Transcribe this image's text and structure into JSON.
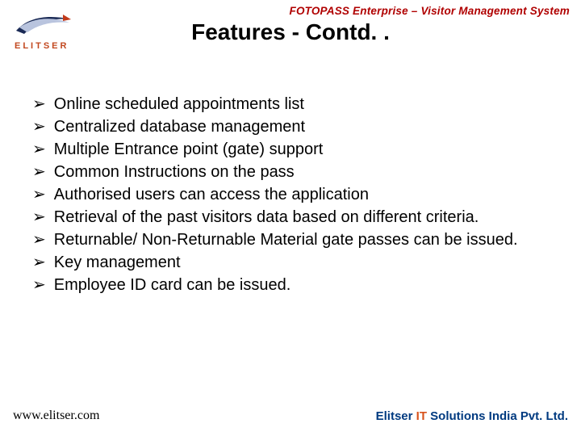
{
  "header": {
    "product_line": "FOTOPASS Enterprise – Visitor Management System",
    "title": "Features - Contd. ."
  },
  "logo": {
    "brand_text": "ELITSER"
  },
  "bullets": [
    "Online scheduled appointments list",
    "Centralized database management",
    "Multiple Entrance point (gate) support",
    "Common Instructions on the pass",
    "Authorised users can access the application",
    "Retrieval of the past visitors data based on different criteria.",
    "Returnable/ Non-Returnable Material gate passes can be issued.",
    "Key management",
    "Employee ID card can be issued."
  ],
  "footer": {
    "url": "www.elitser.com",
    "company_pre": "Elitser ",
    "company_it": "IT",
    "company_post": " Solutions India Pvt. Ltd."
  }
}
